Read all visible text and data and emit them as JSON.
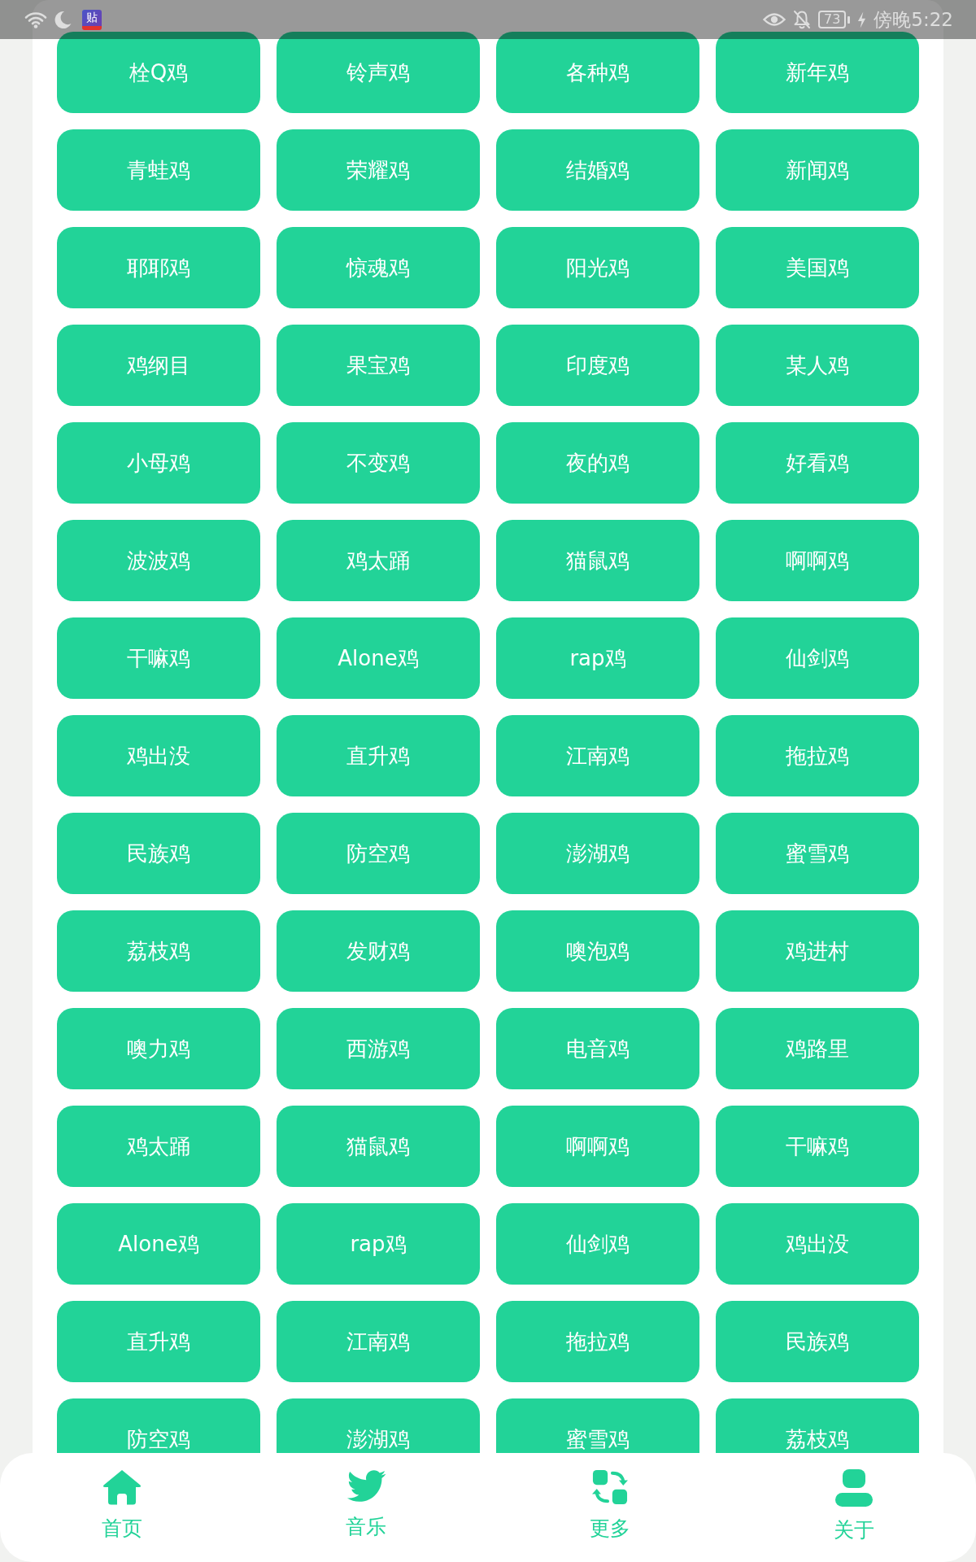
{
  "status_bar": {
    "app_badge": "贴",
    "battery": "73",
    "time": "傍晚5:22"
  },
  "sound_buttons": [
    "栓Q鸡",
    "铃声鸡",
    "各种鸡",
    "新年鸡",
    "青蛙鸡",
    "荣耀鸡",
    "结婚鸡",
    "新闻鸡",
    "耶耶鸡",
    "惊魂鸡",
    "阳光鸡",
    "美国鸡",
    "鸡纲目",
    "果宝鸡",
    "印度鸡",
    "某人鸡",
    "小母鸡",
    "不变鸡",
    "夜的鸡",
    "好看鸡",
    "波波鸡",
    "鸡太踊",
    "猫鼠鸡",
    "啊啊鸡",
    "干嘛鸡",
    "Alone鸡",
    "rap鸡",
    "仙剑鸡",
    "鸡出没",
    "直升鸡",
    "江南鸡",
    "拖拉鸡",
    "民族鸡",
    "防空鸡",
    "澎湖鸡",
    "蜜雪鸡",
    "荔枝鸡",
    "发财鸡",
    "噢泡鸡",
    "鸡进村",
    "噢力鸡",
    "西游鸡",
    "电音鸡",
    "鸡路里",
    "鸡太踊",
    "猫鼠鸡",
    "啊啊鸡",
    "干嘛鸡",
    "Alone鸡",
    "rap鸡",
    "仙剑鸡",
    "鸡出没",
    "直升鸡",
    "江南鸡",
    "拖拉鸡",
    "民族鸡",
    "防空鸡",
    "澎湖鸡",
    "蜜雪鸡",
    "荔枝鸡"
  ],
  "bottom_nav": [
    {
      "kind": "home",
      "label": "首页"
    },
    {
      "kind": "bird",
      "label": "音乐"
    },
    {
      "kind": "swap",
      "label": "更多"
    },
    {
      "kind": "person",
      "label": "关于"
    }
  ]
}
